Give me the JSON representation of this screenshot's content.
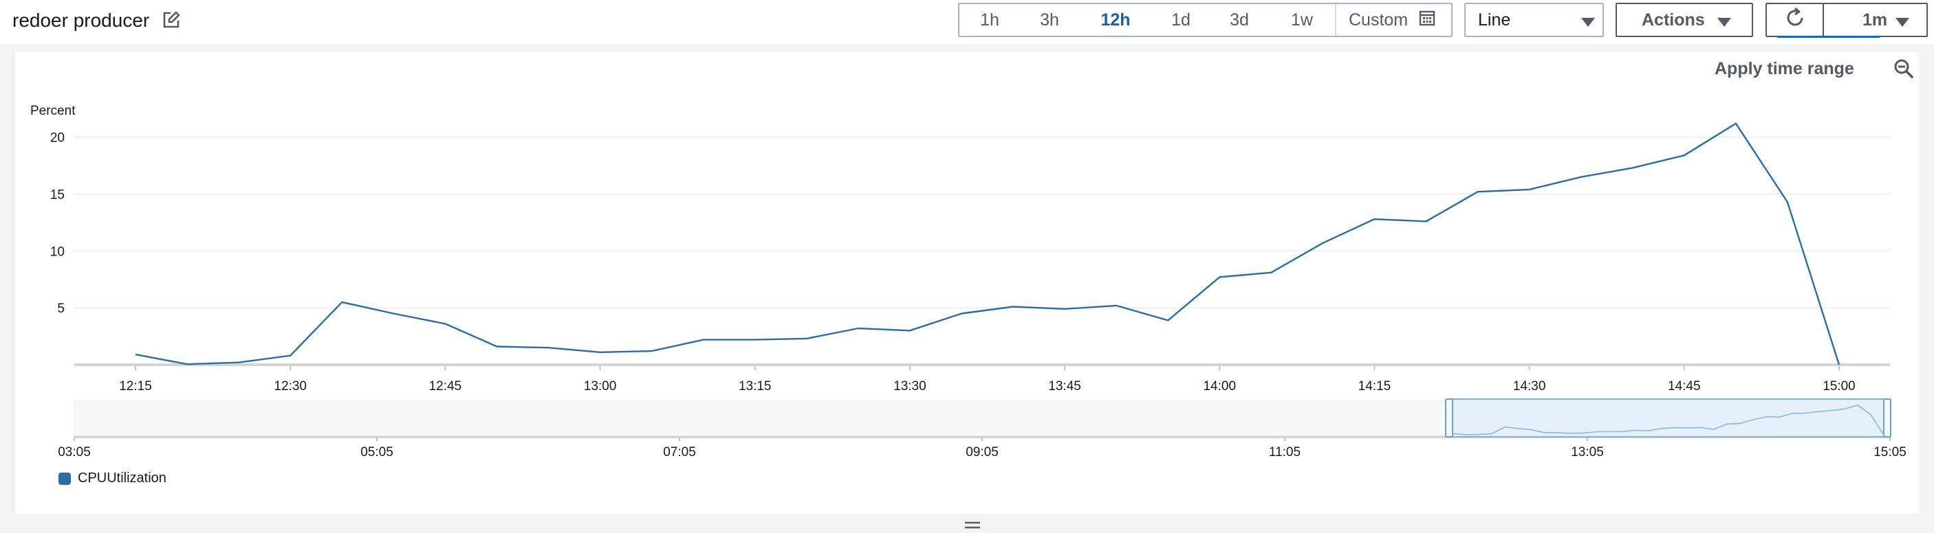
{
  "widget": {
    "title": "redoer producer"
  },
  "toolbar": {
    "time_ranges": [
      {
        "label": "1h",
        "active": false
      },
      {
        "label": "3h",
        "active": false
      },
      {
        "label": "12h",
        "active": true
      },
      {
        "label": "1d",
        "active": false
      },
      {
        "label": "3d",
        "active": false
      },
      {
        "label": "1w",
        "active": false
      }
    ],
    "custom_label": "Custom",
    "chart_type": "Line",
    "actions_label": "Actions",
    "refresh_interval": "1m"
  },
  "panel": {
    "apply_time_range": "Apply time range"
  },
  "colors": {
    "series": "#2e6da4",
    "accent": "#1d5f9a"
  },
  "icons": {
    "edit": "edit-icon",
    "calendar": "calendar-icon",
    "refresh": "refresh-icon",
    "zoom_out": "zoom-out-icon",
    "resize": "resize-handle-icon"
  },
  "chart_data": {
    "type": "line",
    "ylabel": "Percent",
    "yticks": [
      "5",
      "10",
      "15",
      "20"
    ],
    "ylim": [
      0,
      23
    ],
    "x_tick_labels": [
      "12:15",
      "12:30",
      "12:45",
      "13:00",
      "13:15",
      "13:30",
      "13:45",
      "14:00",
      "14:15",
      "14:30",
      "14:45",
      "15:00"
    ],
    "series": [
      {
        "name": "CPUUtilization",
        "x": [
          "12:15",
          "12:20",
          "12:25",
          "12:30",
          "12:35",
          "12:40",
          "12:45",
          "12:50",
          "12:55",
          "13:00",
          "13:05",
          "13:10",
          "13:15",
          "13:20",
          "13:25",
          "13:30",
          "13:35",
          "13:40",
          "13:45",
          "13:50",
          "13:55",
          "14:00",
          "14:05",
          "14:10",
          "14:15",
          "14:20",
          "14:25",
          "14:30",
          "14:35",
          "14:40",
          "14:45",
          "14:50",
          "14:55",
          "15:00"
        ],
        "values": [
          0.9,
          0.05,
          0.2,
          0.8,
          5.5,
          4.5,
          3.6,
          1.6,
          1.5,
          1.1,
          1.2,
          2.2,
          2.2,
          2.3,
          3.2,
          3.0,
          4.5,
          5.1,
          4.9,
          5.2,
          3.9,
          7.7,
          8.1,
          10.7,
          12.8,
          12.6,
          15.2,
          15.4,
          16.5,
          17.3,
          18.4,
          21.2,
          14.3,
          0.0
        ]
      }
    ],
    "overview": {
      "x_tick_labels": [
        "03:05",
        "05:05",
        "07:05",
        "09:05",
        "11:05",
        "13:05",
        "15:05"
      ]
    },
    "legend": "bottom-left"
  }
}
